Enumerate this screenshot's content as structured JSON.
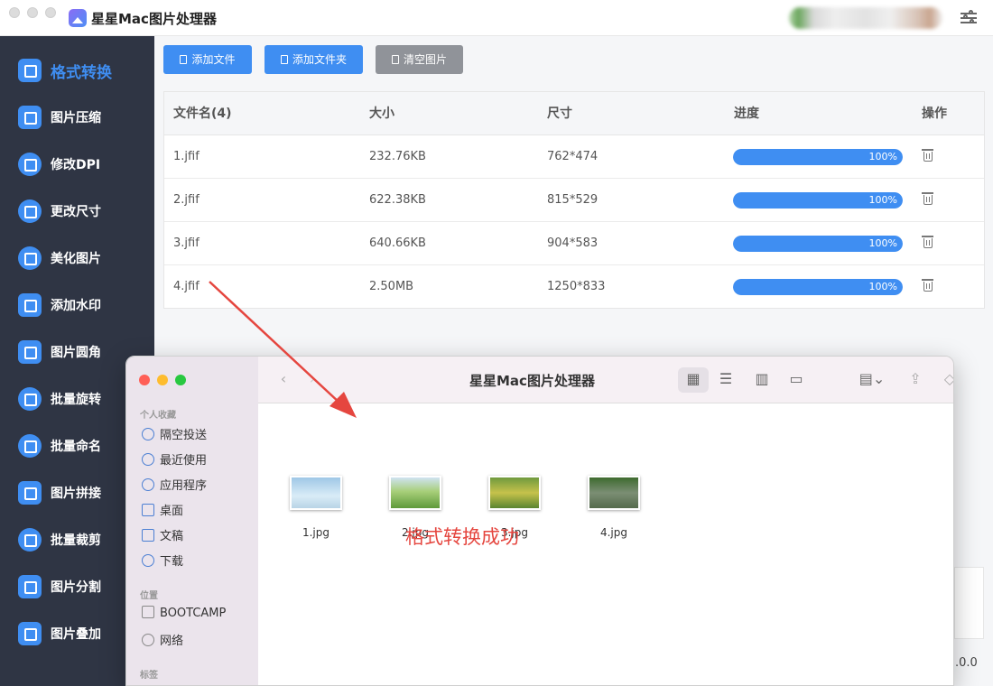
{
  "app": {
    "title": "星星Mac图片处理器"
  },
  "sidebar": {
    "items": [
      {
        "label": "格式转换",
        "icon": "image-convert-icon",
        "active": true
      },
      {
        "label": "图片压缩",
        "icon": "compress-icon"
      },
      {
        "label": "修改DPI",
        "icon": "dpi-icon"
      },
      {
        "label": "更改尺寸",
        "icon": "resize-icon"
      },
      {
        "label": "美化图片",
        "icon": "beautify-icon"
      },
      {
        "label": "添加水印",
        "icon": "watermark-icon"
      },
      {
        "label": "图片圆角",
        "icon": "round-corner-icon"
      },
      {
        "label": "批量旋转",
        "icon": "rotate-icon"
      },
      {
        "label": "批量命名",
        "icon": "rename-icon"
      },
      {
        "label": "图片拼接",
        "icon": "puzzle-icon"
      },
      {
        "label": "批量裁剪",
        "icon": "crop-icon"
      },
      {
        "label": "图片分割",
        "icon": "split-icon"
      },
      {
        "label": "图片叠加",
        "icon": "layers-icon"
      }
    ]
  },
  "toolbar": {
    "add_file": "添加文件",
    "add_folder": "添加文件夹",
    "clear": "清空图片"
  },
  "table": {
    "headers": [
      "文件名(4)",
      "大小",
      "尺寸",
      "进度",
      "操作"
    ],
    "rows": [
      {
        "name": "1.jfif",
        "size": "232.76KB",
        "dims": "762*474",
        "progress": 100,
        "progress_label": "100%"
      },
      {
        "name": "2.jfif",
        "size": "622.38KB",
        "dims": "815*529",
        "progress": 100,
        "progress_label": "100%"
      },
      {
        "name": "3.jfif",
        "size": "640.66KB",
        "dims": "904*583",
        "progress": 100,
        "progress_label": "100%"
      },
      {
        "name": "4.jfif",
        "size": "2.50MB",
        "dims": "1250*833",
        "progress": 100,
        "progress_label": "100%"
      }
    ]
  },
  "version_fragment": ".0.0",
  "finder": {
    "title": "星星Mac图片处理器",
    "favorites_heading": "个人收藏",
    "favorites": [
      "隔空投送",
      "最近使用",
      "应用程序",
      "桌面",
      "文稿",
      "下载"
    ],
    "locations_heading": "位置",
    "locations": [
      "BOOTCAMP",
      "网络"
    ],
    "tags_heading": "标签",
    "files": [
      "1.jpg",
      "2.jpg",
      "3.jpg",
      "4.jpg"
    ]
  },
  "annotation": {
    "text": "格式转换成功",
    "color": "#e5463f"
  },
  "colors": {
    "accent": "#3f8ef2",
    "sidebar_bg": "#2f3544",
    "clear_button": "#909399"
  }
}
